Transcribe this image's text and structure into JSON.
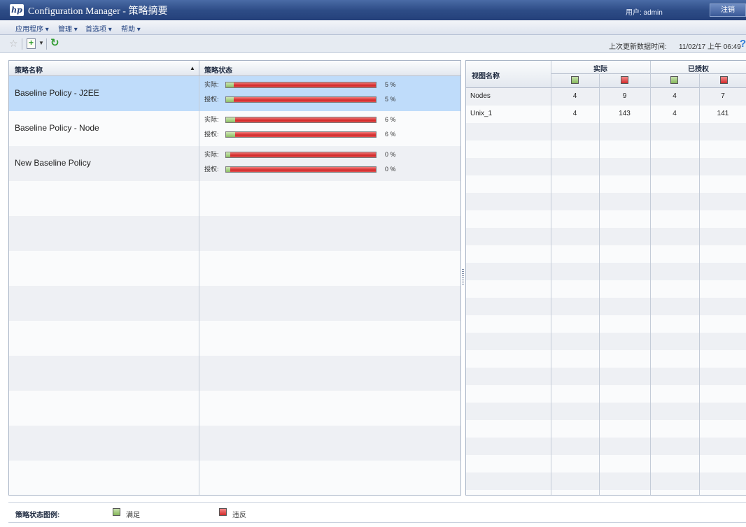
{
  "window": {
    "logo_text": "hp",
    "title": "Configuration Manager - 策略摘要",
    "user_label": "用户: admin",
    "logout_label": "注销"
  },
  "menu": {
    "items": [
      "应用程序 ▾",
      "管理 ▾",
      "首选项 ▾",
      "帮助 ▾"
    ]
  },
  "toolbar": {
    "icons": [
      "star-icon",
      "new-policy-icon",
      "chevron-down-icon",
      "refresh-icon",
      "help-icon"
    ],
    "last_update_label": "上次更新数据时间:",
    "last_update_value": "11/02/17 上午 06:49",
    "help_glyph": "?"
  },
  "policy_table": {
    "headers": {
      "name": "策略名称",
      "status": "策略状态"
    },
    "sort_indicator": "▲",
    "rows": [
      {
        "name": "Baseline Policy - J2EE",
        "selected": true,
        "actual_label": "实际:",
        "actual_pct": 5,
        "actual_text": "5 %",
        "authorized_label": "授权:",
        "authorized_pct": 5,
        "authorized_text": "5 %"
      },
      {
        "name": "Baseline Policy - Node",
        "selected": false,
        "actual_label": "实际:",
        "actual_pct": 6,
        "actual_text": "6 %",
        "authorized_label": "授权:",
        "authorized_pct": 6,
        "authorized_text": "6 %"
      },
      {
        "name": "New Baseline Policy",
        "selected": false,
        "actual_label": "实际:",
        "actual_pct": 0,
        "actual_text": "0 %",
        "authorized_label": "授权:",
        "authorized_pct": 0,
        "authorized_text": "0 %"
      }
    ]
  },
  "view_table": {
    "headers": {
      "view_name": "视图名称",
      "actual": "实际",
      "authorized": "已授权"
    },
    "rows": [
      {
        "name": "Nodes",
        "actual_compliant": "4",
        "actual_violation": "9",
        "auth_compliant": "4",
        "auth_violation": "7"
      },
      {
        "name": "Unix_1",
        "actual_compliant": "4",
        "actual_violation": "143",
        "auth_compliant": "4",
        "auth_violation": "141"
      }
    ]
  },
  "legend": {
    "title": "策略状态图例:",
    "compliant": "满足",
    "violation": "违反"
  },
  "colors": {
    "compliant": "#8cbf63",
    "violation": "#d22b2b",
    "selected_row": "#bfdcfa",
    "title_bar": "#2e4d87"
  }
}
